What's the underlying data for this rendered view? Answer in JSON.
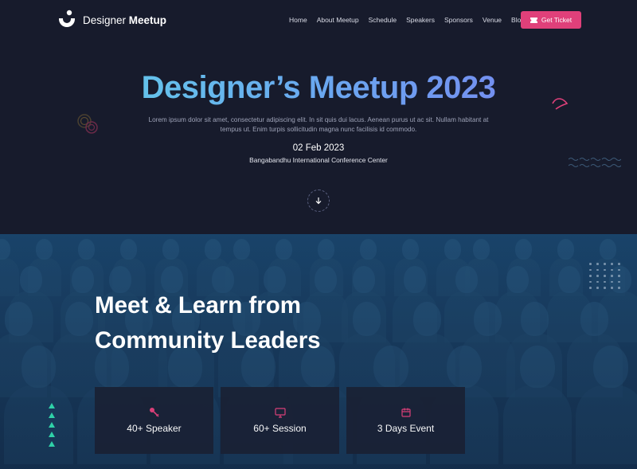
{
  "brand": {
    "name_regular": "Designer",
    "name_bold": "Meetup"
  },
  "nav": {
    "items": [
      "Home",
      "About Meetup",
      "Schedule",
      "Speakers",
      "Sponsors",
      "Venue",
      "Blog"
    ],
    "cta_label": "Get Ticket"
  },
  "hero": {
    "title": "Designer’s Meetup 2023",
    "description": "Lorem ipsum dolor sit amet, consectetur adipiscing elit. In sit quis dui lacus. Aenean purus ut ac sit. Nullam habitant at tempus ut. Enim turpis sollicitudin magna nunc facilisis id commodo.",
    "date": "02 Feb 2023",
    "venue": "Bangabandhu International Conference Center"
  },
  "section": {
    "title_line1": "Meet & Learn from",
    "title_line2": "Community Leaders"
  },
  "stats": [
    {
      "label": "40+ Speaker",
      "icon": "microphone-icon"
    },
    {
      "label": "60+ Session",
      "icon": "monitor-icon"
    },
    {
      "label": "3 Days Event",
      "icon": "calendar-icon"
    }
  ],
  "colors": {
    "background": "#171b2c",
    "accent": "#e0407a",
    "title_gradient_start": "#5fd6e6",
    "title_gradient_end": "#7b7df0",
    "triangle": "#2fd1a8"
  }
}
